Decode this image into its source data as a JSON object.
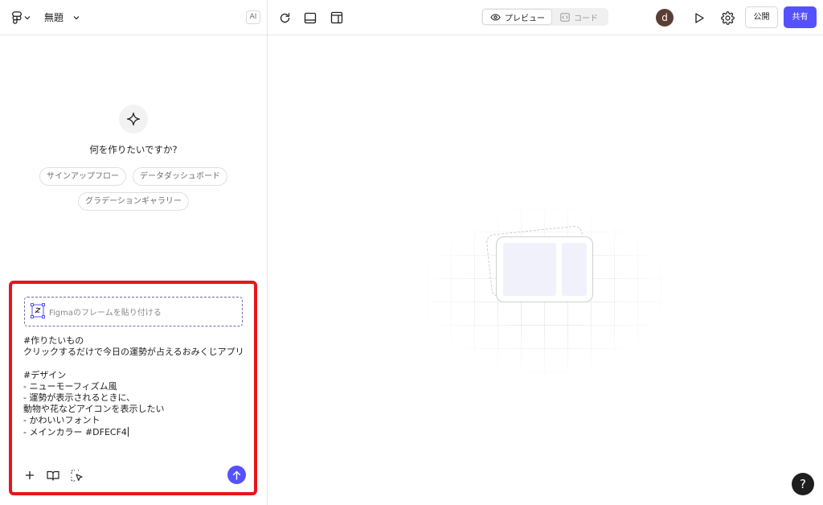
{
  "header": {
    "file_name": "無題",
    "ai_badge": "AI"
  },
  "toolbar": {
    "preview_label": "プレビュー",
    "code_label": "コード",
    "avatar_initial": "d",
    "publish_label": "公開",
    "share_label": "共有"
  },
  "empty_state": {
    "question": "何を作りたいですか?",
    "suggestions": [
      "サインアップフロー",
      "データダッシュボード",
      "グラデーションギャラリー"
    ]
  },
  "composer": {
    "paste_frame_label": "Figmaのフレームを貼り付ける",
    "prompt_text": "#作りたいもの\nクリックするだけで今日の運勢が占えるおみくじアプリ\n\n#デザイン\n- ニューモーフィズム風\n- 運勢が表示されるときに、\n動物や花などアイコンを表示したい\n- かわいいフォント\n- メインカラー #DFECF4"
  },
  "help": {
    "label": "?"
  },
  "colors": {
    "accent": "#5551ff",
    "highlight_border": "#e8141c",
    "avatar": "#5a3d35"
  },
  "icons": [
    "figma-logo-icon",
    "chevron-down-icon",
    "sparkle-icon",
    "frame-paste-icon",
    "plus-icon",
    "book-icon",
    "cursor-select-icon",
    "arrow-up-icon",
    "refresh-icon",
    "panel-bottom-icon",
    "layout-icon",
    "eye-icon",
    "code-icon",
    "play-icon",
    "gear-icon"
  ]
}
